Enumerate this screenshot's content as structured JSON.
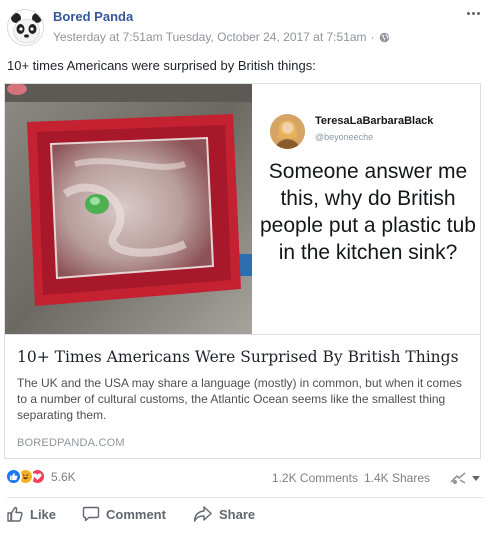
{
  "post": {
    "page_name": "Bored Panda",
    "timestamp": "Yesterday at 7:51am Tuesday, October 24, 2017 at 7:51am",
    "separator": "·",
    "text": "10+ times Americans were surprised by British things:"
  },
  "tweet": {
    "name": "TeresaLaBarbaraBlack",
    "handle": "@beyoneeche",
    "text": "Someone answer me this, why do British people put a plastic tub in the kitchen sink?"
  },
  "link_card": {
    "title": "10+ Times Americans Were Surprised By British Things",
    "description": "The UK and the USA may share a language (mostly) in common, but when it comes to a number of cultural customs, the Atlantic Ocean seems like the smallest thing separating them.",
    "domain": "BOREDPANDA.COM"
  },
  "engagement": {
    "reactions_count": "5.6K",
    "comments": "1.2K Comments",
    "shares": "1.4K Shares"
  },
  "actions": {
    "like": "Like",
    "comment": "Comment",
    "share": "Share"
  },
  "colors": {
    "link_blue": "#365899",
    "like_blue": "#1877f2",
    "love_red": "#f33e58",
    "haha_yellow": "#f7b125",
    "tub_red": "#c42131"
  },
  "icons": [
    "more-icon",
    "globe-icon",
    "like-reaction-icon",
    "haha-reaction-icon",
    "love-reaction-icon",
    "audience-icon",
    "like-icon",
    "comment-icon",
    "share-icon"
  ]
}
